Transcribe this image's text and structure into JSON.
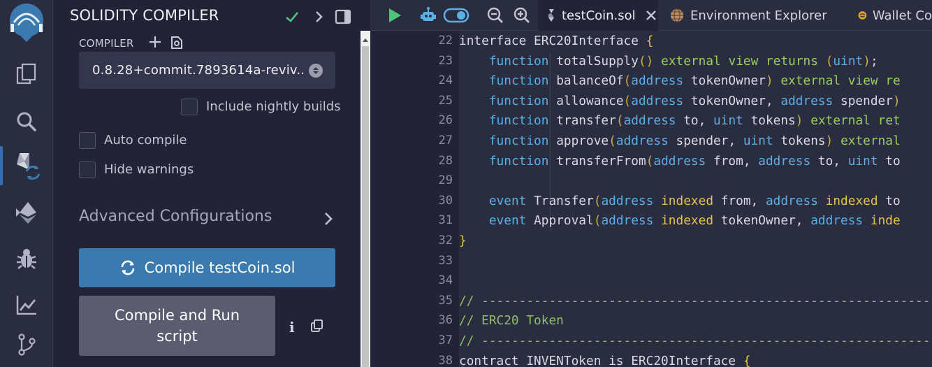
{
  "sidebar_panel": {
    "title": "SOLIDITY COMPILER",
    "compiler_label": "COMPILER",
    "version_selected": "0.8.28+commit.7893614a-reviv...",
    "include_nightly_label": "Include nightly builds",
    "auto_compile_label": "Auto compile",
    "hide_warnings_label": "Hide warnings",
    "advanced_label": "Advanced Configurations",
    "compile_button_label": "Compile testCoin.sol",
    "run_button_label": "Compile and Run script",
    "info_glyph": "i",
    "accent_color": "#3a7aae"
  },
  "rail": {
    "icons": [
      "remix-logo-icon",
      "file-explorer-icon",
      "search-icon",
      "solidity-compiler-icon",
      "deploy-run-icon",
      "debugger-icon",
      "analysis-icon",
      "git-icon"
    ],
    "active": "solidity-compiler-icon"
  },
  "editor_tabs": [
    {
      "label": "testCoin.sol",
      "active": true
    },
    {
      "label": "Environment Explorer",
      "active": false
    },
    {
      "label": "Wallet Co",
      "active": false
    }
  ],
  "code": {
    "line_numbers": [
      "22",
      "23",
      "24",
      "25",
      "26",
      "27",
      "28",
      "29",
      "30",
      "31",
      "32",
      "33",
      "34",
      "35",
      "36",
      "37",
      "38"
    ],
    "lines": [
      "interface ERC20Interface {",
      "    function totalSupply() external view returns (uint);",
      "    function balanceOf(address tokenOwner) external view re",
      "    function allowance(address tokenOwner, address spender)",
      "    function transfer(address to, uint tokens) external ret",
      "    function approve(address spender, uint tokens) external",
      "    function transferFrom(address from, address to, uint to",
      "",
      "    event Transfer(address indexed from, address indexed to",
      "    event Approval(address indexed tokenOwner, address inde",
      "}",
      "",
      "",
      "// ----------------------------------------------------------------",
      "// ERC20 Token",
      "// ----------------------------------------------------------------",
      "contract INVENToken is ERC20Interface {"
    ]
  }
}
